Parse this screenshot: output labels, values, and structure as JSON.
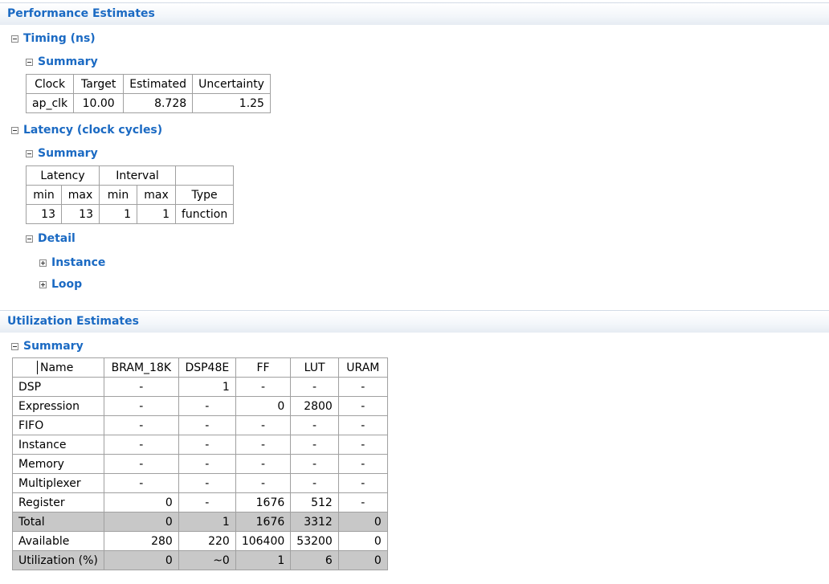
{
  "performance": {
    "title": "Performance Estimates",
    "timing": {
      "title": "Timing (ns)",
      "summary_title": "Summary",
      "headers": [
        "Clock",
        "Target",
        "Estimated",
        "Uncertainty"
      ],
      "rows": [
        [
          "ap_clk",
          "10.00",
          "8.728",
          "1.25"
        ]
      ]
    },
    "latency": {
      "title": "Latency (clock cycles)",
      "summary_title": "Summary",
      "group_headers": [
        "Latency",
        "Interval",
        ""
      ],
      "sub_headers": [
        "min",
        "max",
        "min",
        "max",
        "Type"
      ],
      "rows": [
        [
          "13",
          "13",
          "1",
          "1",
          "function"
        ]
      ],
      "detail": {
        "title": "Detail",
        "items": [
          "Instance",
          "Loop"
        ]
      }
    }
  },
  "utilization": {
    "title": "Utilization Estimates",
    "summary_title": "Summary",
    "headers": [
      "Name",
      "BRAM_18K",
      "DSP48E",
      "FF",
      "LUT",
      "URAM"
    ],
    "rows": [
      [
        "DSP",
        "-",
        "1",
        "-",
        "-",
        "-"
      ],
      [
        "Expression",
        "-",
        "-",
        "0",
        "2800",
        "-"
      ],
      [
        "FIFO",
        "-",
        "-",
        "-",
        "-",
        "-"
      ],
      [
        "Instance",
        "-",
        "-",
        "-",
        "-",
        "-"
      ],
      [
        "Memory",
        "-",
        "-",
        "-",
        "-",
        "-"
      ],
      [
        "Multiplexer",
        "-",
        "-",
        "-",
        "-",
        "-"
      ],
      [
        "Register",
        "0",
        "-",
        "1676",
        "512",
        "-"
      ],
      [
        "Total",
        "0",
        "1",
        "1676",
        "3312",
        "0"
      ],
      [
        "Available",
        "280",
        "220",
        "106400",
        "53200",
        "0"
      ],
      [
        "Utilization (%)",
        "0",
        "~0",
        "1",
        "6",
        "0"
      ]
    ]
  }
}
